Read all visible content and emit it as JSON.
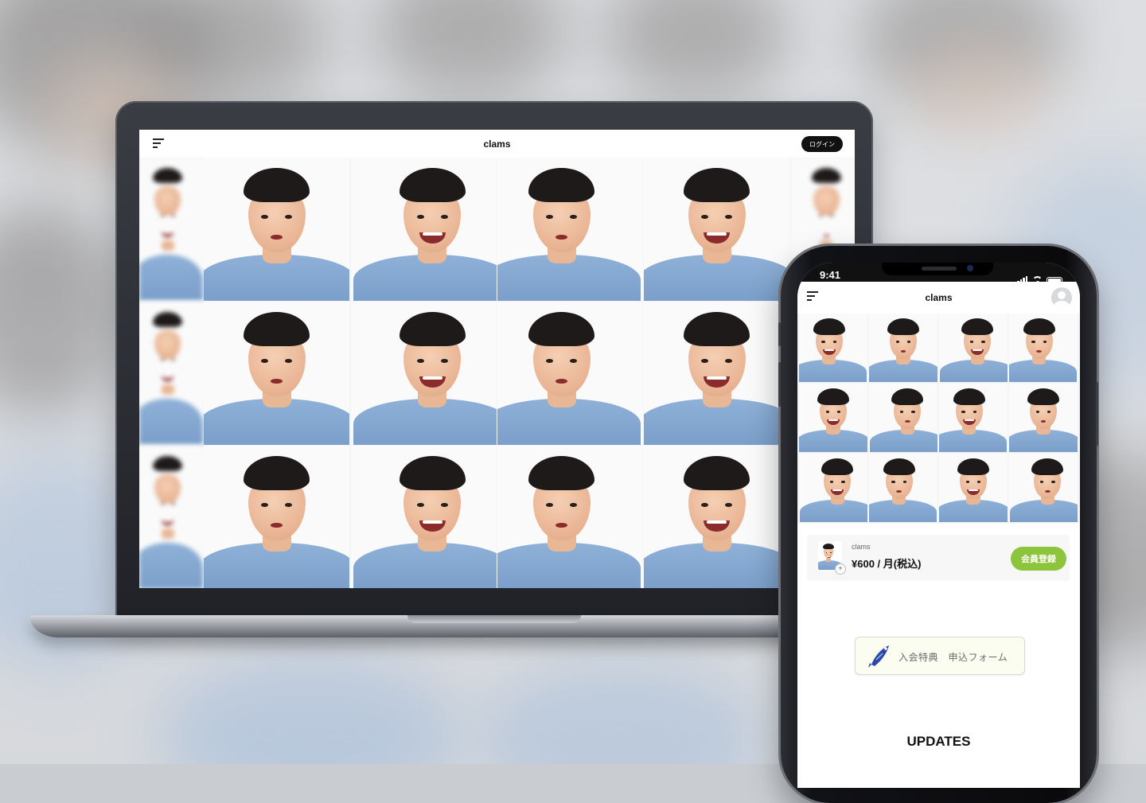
{
  "desktop": {
    "brand": "clams",
    "login_label": "ログイン"
  },
  "mobile": {
    "status_time": "9:41",
    "brand": "clams",
    "plan": {
      "name": "clams",
      "price": "¥600 / 月(税込)",
      "join_label": "会員登録"
    },
    "form_banner_label": "入会特典　申込フォーム",
    "updates_title": "UPDATES"
  },
  "colors": {
    "accent_green": "#8cc43c",
    "shirt_blue": "#7fa3cf",
    "dark": "#111111"
  },
  "icons": [
    "menu-icon",
    "avatar-icon",
    "wifi-icon",
    "battery-icon",
    "signal-icon",
    "fish-icon"
  ]
}
